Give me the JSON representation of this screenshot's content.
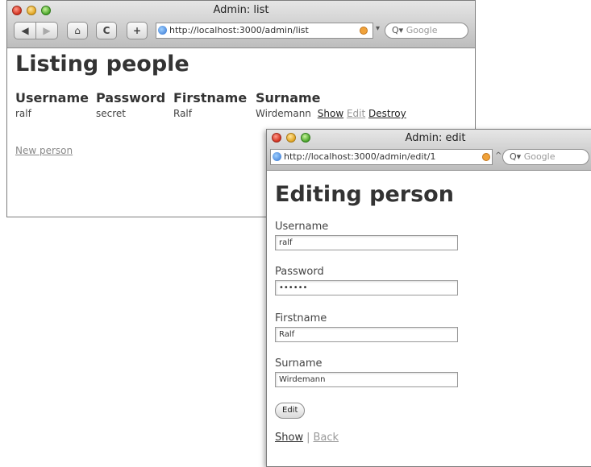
{
  "list_window": {
    "title": "Admin: list",
    "url": "http://localhost:3000/admin/list",
    "search_placeholder": "Google",
    "heading": "Listing people",
    "columns": [
      "Username",
      "Password",
      "Firstname",
      "Surname"
    ],
    "rows": [
      {
        "username": "ralf",
        "password": "secret",
        "firstname": "Ralf",
        "surname": "Wirdemann",
        "actions": {
          "show": "Show",
          "edit": "Edit",
          "destroy": "Destroy"
        }
      }
    ],
    "new_link": "New person"
  },
  "edit_window": {
    "title": "Admin: edit",
    "url": "http://localhost:3000/admin/edit/1",
    "search_placeholder": "Google",
    "heading": "Editing person",
    "fields": {
      "username": {
        "label": "Username",
        "value": "ralf"
      },
      "password": {
        "label": "Password",
        "value": "••••••"
      },
      "firstname": {
        "label": "Firstname",
        "value": "Ralf"
      },
      "surname": {
        "label": "Surname",
        "value": "Wirdemann"
      }
    },
    "submit_label": "Edit",
    "links": {
      "show": "Show",
      "separator": "|",
      "back": "Back"
    }
  },
  "glyphs": {
    "back": "◀",
    "forward": "▶",
    "home": "⌂",
    "reload": "C",
    "add": "+",
    "search": "Q▾",
    "dropdown": "▾",
    "caret": "^"
  }
}
